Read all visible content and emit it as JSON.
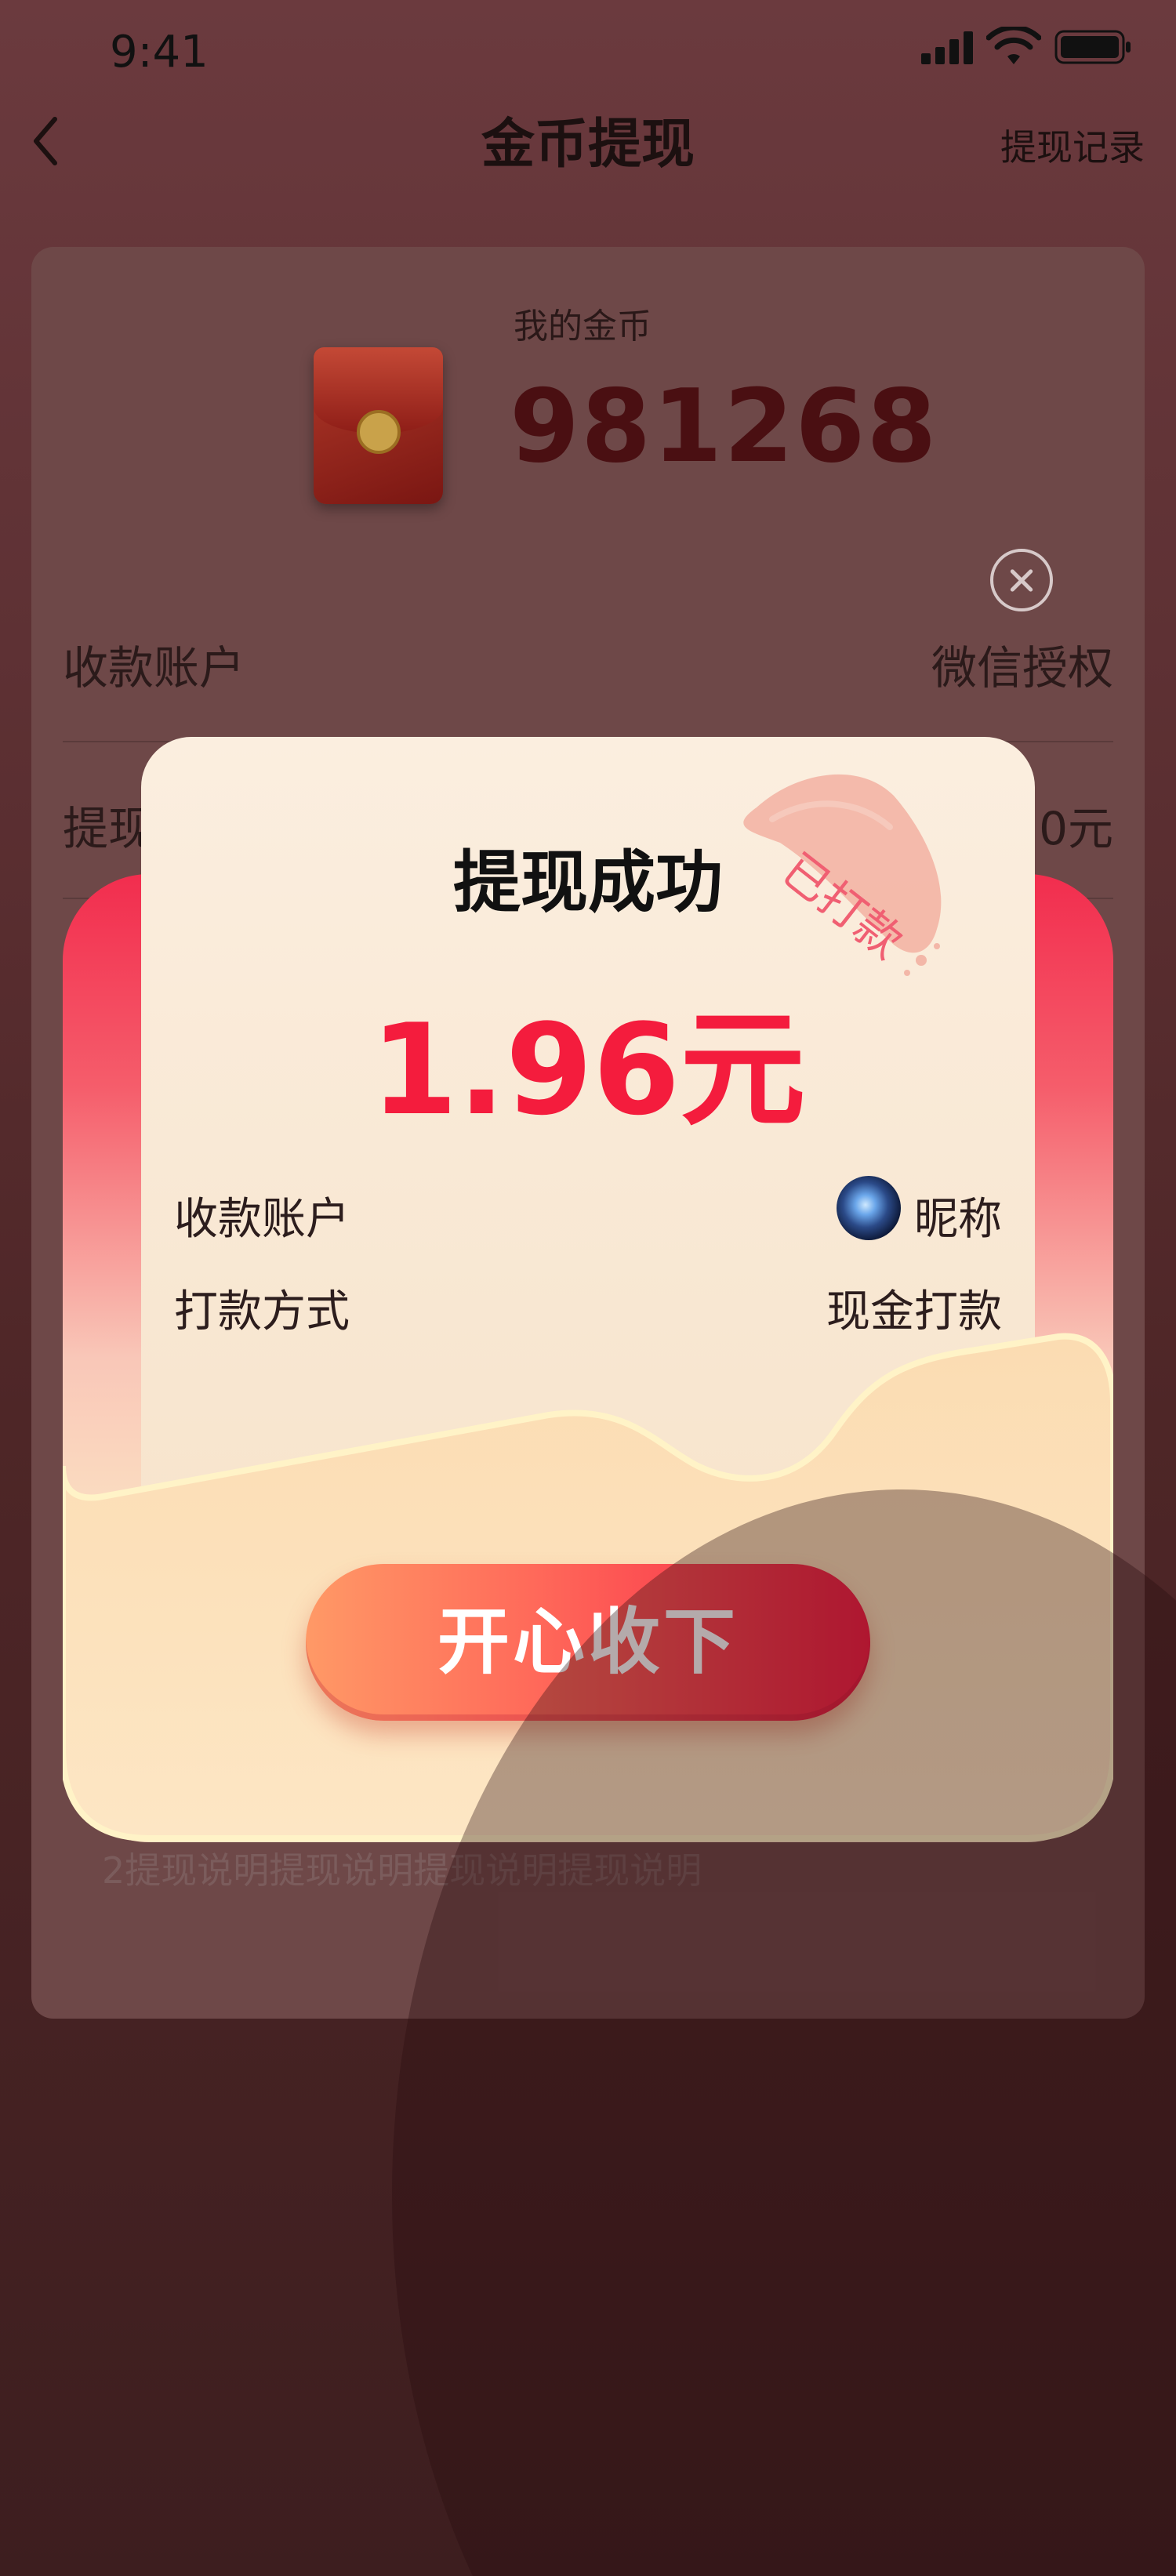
{
  "status_bar": {
    "time": "9:41"
  },
  "nav": {
    "title": "金币提现",
    "right_link": "提现记录"
  },
  "wallet": {
    "coin_label": "我的金币",
    "coin_value": "981268",
    "account_label": "收款账户",
    "account_value": "微信授权",
    "withdraw_label": "提现",
    "withdraw_value_partial": "0元",
    "note": "2提现说明提现说明提现说明提现说明"
  },
  "modal": {
    "stamp": "已打款",
    "title": "提现成功",
    "amount": "1.96元",
    "rows": [
      {
        "label": "收款账户",
        "value": "昵称"
      },
      {
        "label": "打款方式",
        "value": "现金打款"
      }
    ],
    "confirm_button": "开心收下"
  },
  "colors": {
    "accent": "#f41c3d",
    "button_start": "#ff9966",
    "button_end": "#f71d43"
  }
}
